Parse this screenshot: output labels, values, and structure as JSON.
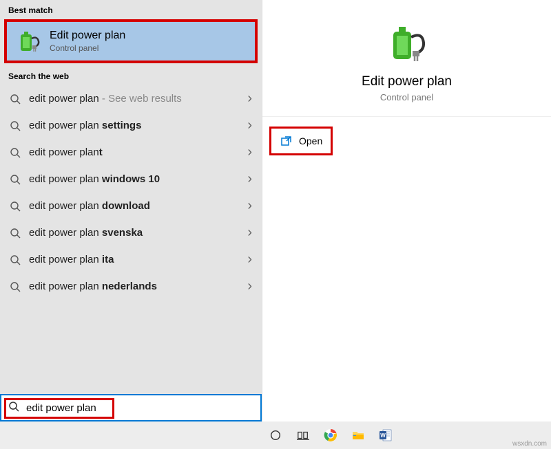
{
  "left": {
    "bestMatchLabel": "Best match",
    "bestMatch": {
      "title": "Edit power plan",
      "subtitle": "Control panel"
    },
    "searchWebLabel": "Search the web",
    "webResults": [
      {
        "prefix": "edit power plan",
        "bold": "",
        "suffix": " - See web results",
        "muted": true
      },
      {
        "prefix": "edit power plan ",
        "bold": "settings",
        "suffix": "",
        "muted": false
      },
      {
        "prefix": "edit power plan",
        "bold": "t",
        "suffix": "",
        "muted": false
      },
      {
        "prefix": "edit power plan ",
        "bold": "windows 10",
        "suffix": "",
        "muted": false
      },
      {
        "prefix": "edit power plan ",
        "bold": "download",
        "suffix": "",
        "muted": false
      },
      {
        "prefix": "edit power plan ",
        "bold": "svenska",
        "suffix": "",
        "muted": false
      },
      {
        "prefix": "edit power plan ",
        "bold": "ita",
        "suffix": "",
        "muted": false
      },
      {
        "prefix": "edit power plan ",
        "bold": "nederlands",
        "suffix": "",
        "muted": false
      }
    ]
  },
  "right": {
    "title": "Edit power plan",
    "subtitle": "Control panel",
    "openLabel": "Open"
  },
  "searchBar": {
    "value": "edit power plan"
  },
  "taskbar": {
    "icons": [
      "cortana-circle",
      "task-view",
      "chrome",
      "file-explorer",
      "word"
    ]
  },
  "watermark": "wsxdn.com"
}
